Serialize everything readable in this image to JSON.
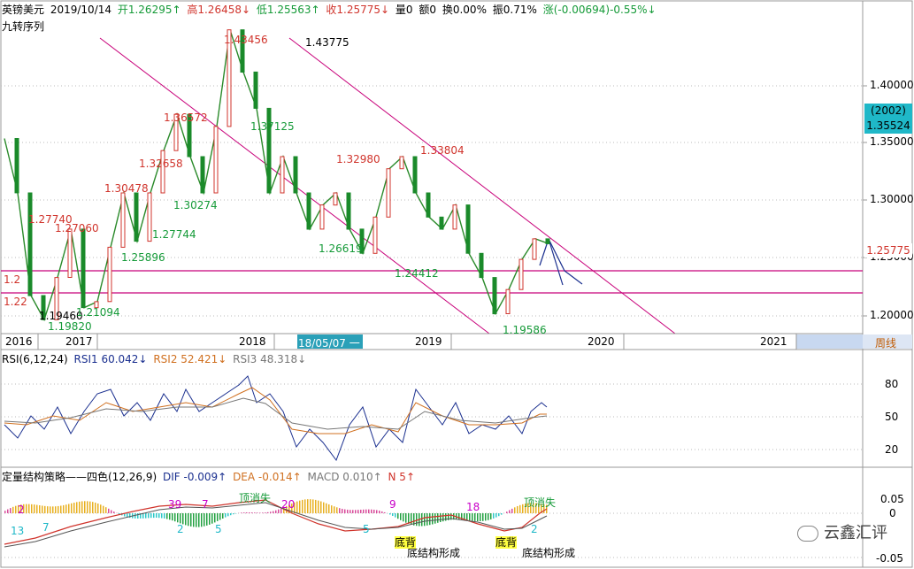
{
  "header": {
    "symbol": "英镑美元",
    "date": "2019/10/14",
    "open": "开1.26295↑",
    "high": "高1.26458↓",
    "low": "低1.25563↑",
    "close": "收1.25775↓",
    "volume": "量0",
    "amount": "额0",
    "turnover": "换0.00%",
    "amplitude": "振0.71%",
    "change": "涨(-0.00694)-0.55%↓"
  },
  "indicator_title": "九转序列",
  "period_label": "周线",
  "cursor_date": "18/05/07 一",
  "years": [
    "2016",
    "2017",
    "2018",
    "2019",
    "2020",
    "2021"
  ],
  "price_axis": [
    "1.40000",
    "1.35000",
    "1.30000",
    "1.25000",
    "1.20000"
  ],
  "price_box": {
    "label": "(2002)",
    "value": "1.35524"
  },
  "current_price": "1.25775",
  "rsi_header": {
    "name": "RSI(6,12,24)",
    "r1": "RSI1 60.042↓",
    "r2": "RSI2 52.421↓",
    "r3": "RSI3 48.318↓"
  },
  "rsi_axis": [
    "80",
    "50",
    "20"
  ],
  "macd_header": {
    "name": "定量结构策略——四色(12,26,9)",
    "dif": "DIF -0.009↑",
    "dea": "DEA -0.014↑",
    "macd": "MACD 0.010↑",
    "n": "N 5↑"
  },
  "macd_axis": [
    "0.05",
    "0",
    "-0.05"
  ],
  "watermark": "云鑫汇评",
  "annotations": {
    "top_peak": "1.43456",
    "peak": "1.43775",
    "a1": "1.36572",
    "a2": "1.37125",
    "a3": "1.32658",
    "a4": "1.30478",
    "a5": "1.30274",
    "a6": "1.27740",
    "a7": "1.27060",
    "a8": "1.27744",
    "a9": "1.25896",
    "a10": "1.32980",
    "a11": "1.33804",
    "a12": "1.26619",
    "a13": "1.24412",
    "a14": "1.19460",
    "a15": "1.19820",
    "a16": "1.21094",
    "a17": "1.19586",
    "edge1": "1.2",
    "edge2": "1.22"
  },
  "macd_labels": {
    "top_sig1": "顶消失",
    "top_sig2": "顶消失",
    "bottom_struct1": "底结构形成",
    "bottom_struct2": "底结构形成",
    "bottom_tag1": "底背",
    "bottom_tag2": "底背",
    "seq": [
      "13",
      "7",
      "2",
      "39",
      "7",
      "20",
      "9",
      "18",
      "2",
      "5",
      "5",
      "2"
    ]
  },
  "chart_data": {
    "type": "line",
    "title": "",
    "xlabel": "",
    "ylabel": "",
    "ylim": [
      1.185,
      1.445
    ],
    "series": [
      {
        "values": [
          1.345,
          1.3,
          1.215,
          1.195,
          1.23,
          1.27,
          1.205,
          1.21,
          1.255,
          1.3,
          1.26,
          1.3,
          1.335,
          1.365,
          1.33,
          1.3,
          1.355,
          1.435,
          1.4,
          1.37,
          1.3,
          1.33,
          1.3,
          1.27,
          1.29,
          1.3,
          1.27,
          1.25,
          1.28,
          1.32,
          1.33,
          1.3,
          1.28,
          1.27,
          1.29,
          1.25,
          1.23,
          1.2,
          1.22,
          1.245,
          1.262,
          1.258
        ]
      }
    ]
  }
}
